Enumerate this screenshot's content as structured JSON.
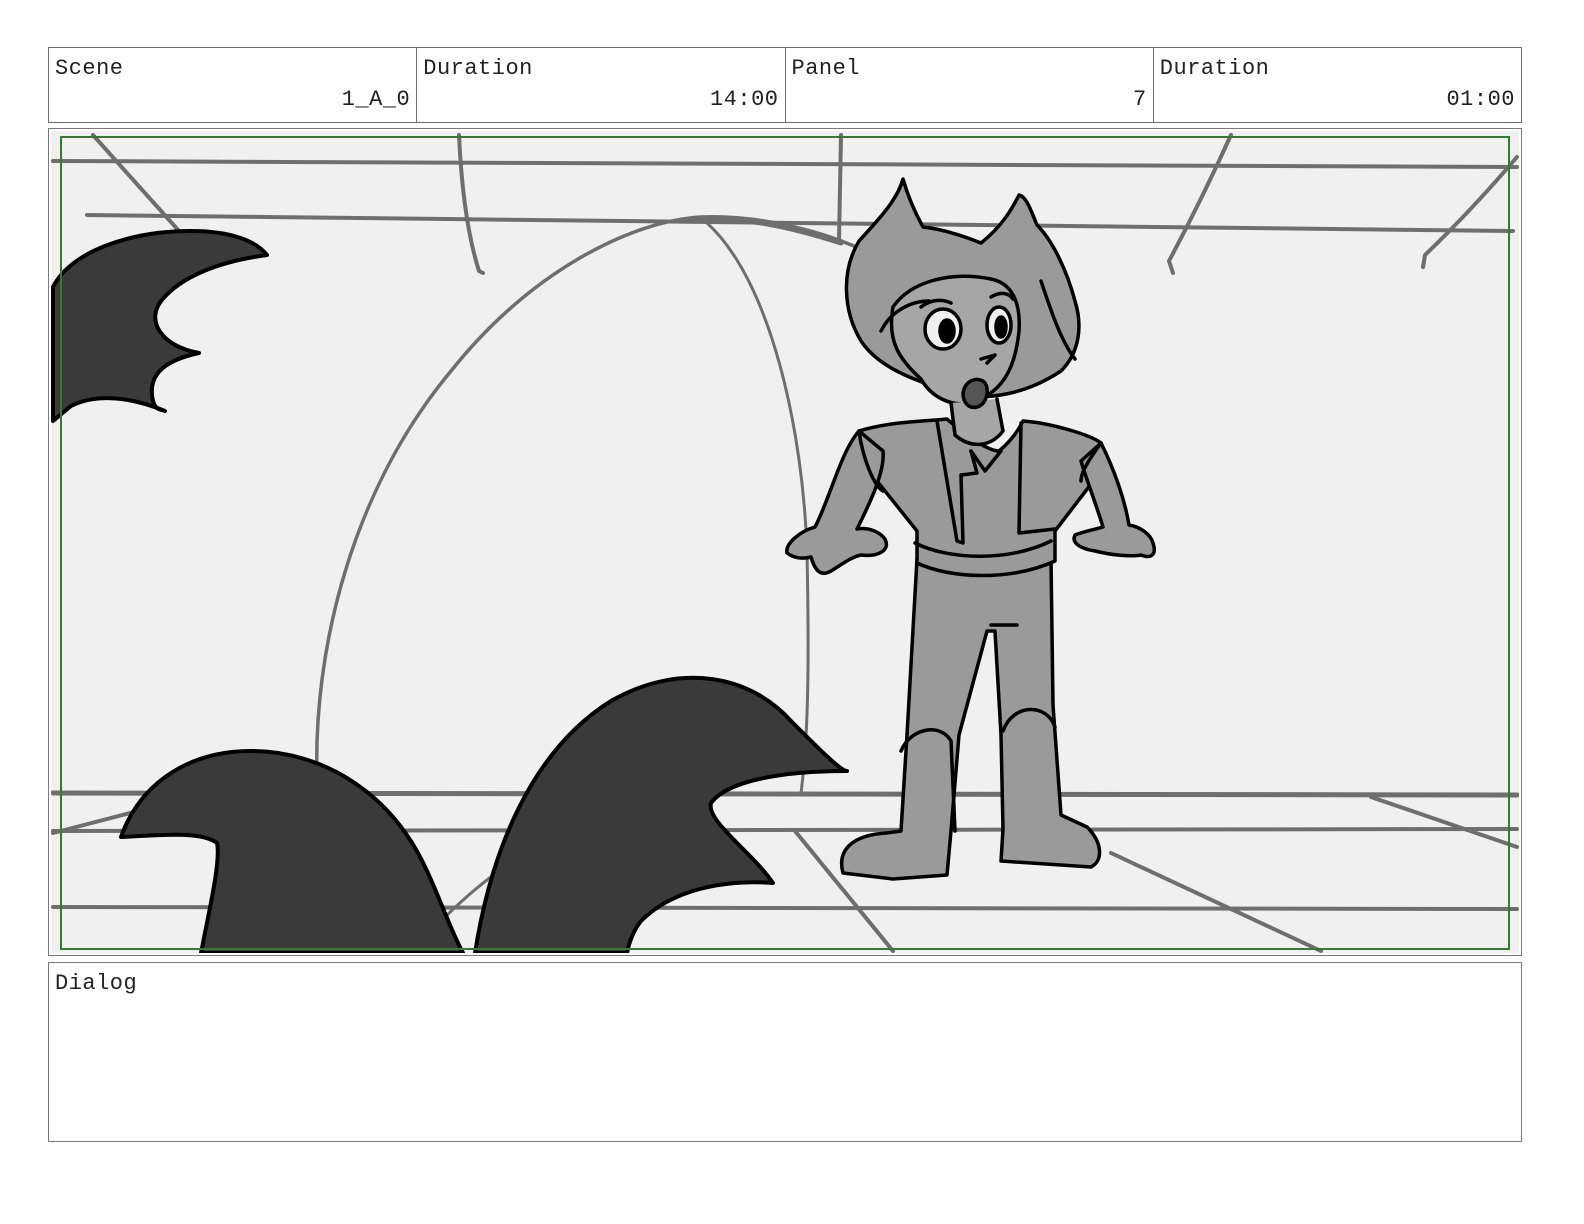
{
  "header": {
    "scene": {
      "label": "Scene",
      "value": "1_A_0"
    },
    "scene_duration": {
      "label": "Duration",
      "value": "14:00"
    },
    "panel": {
      "label": "Panel",
      "value": "7"
    },
    "panel_duration": {
      "label": "Duration",
      "value": "01:00"
    }
  },
  "artwork": {
    "colors": {
      "background": "#f0f0f0",
      "line": "#6e6e6e",
      "character_fill": "#9a9a9a",
      "foreground_fill": "#3a3a3a",
      "safe_area": "#2e7d32"
    }
  },
  "dialog": {
    "label": "Dialog",
    "text": ""
  }
}
